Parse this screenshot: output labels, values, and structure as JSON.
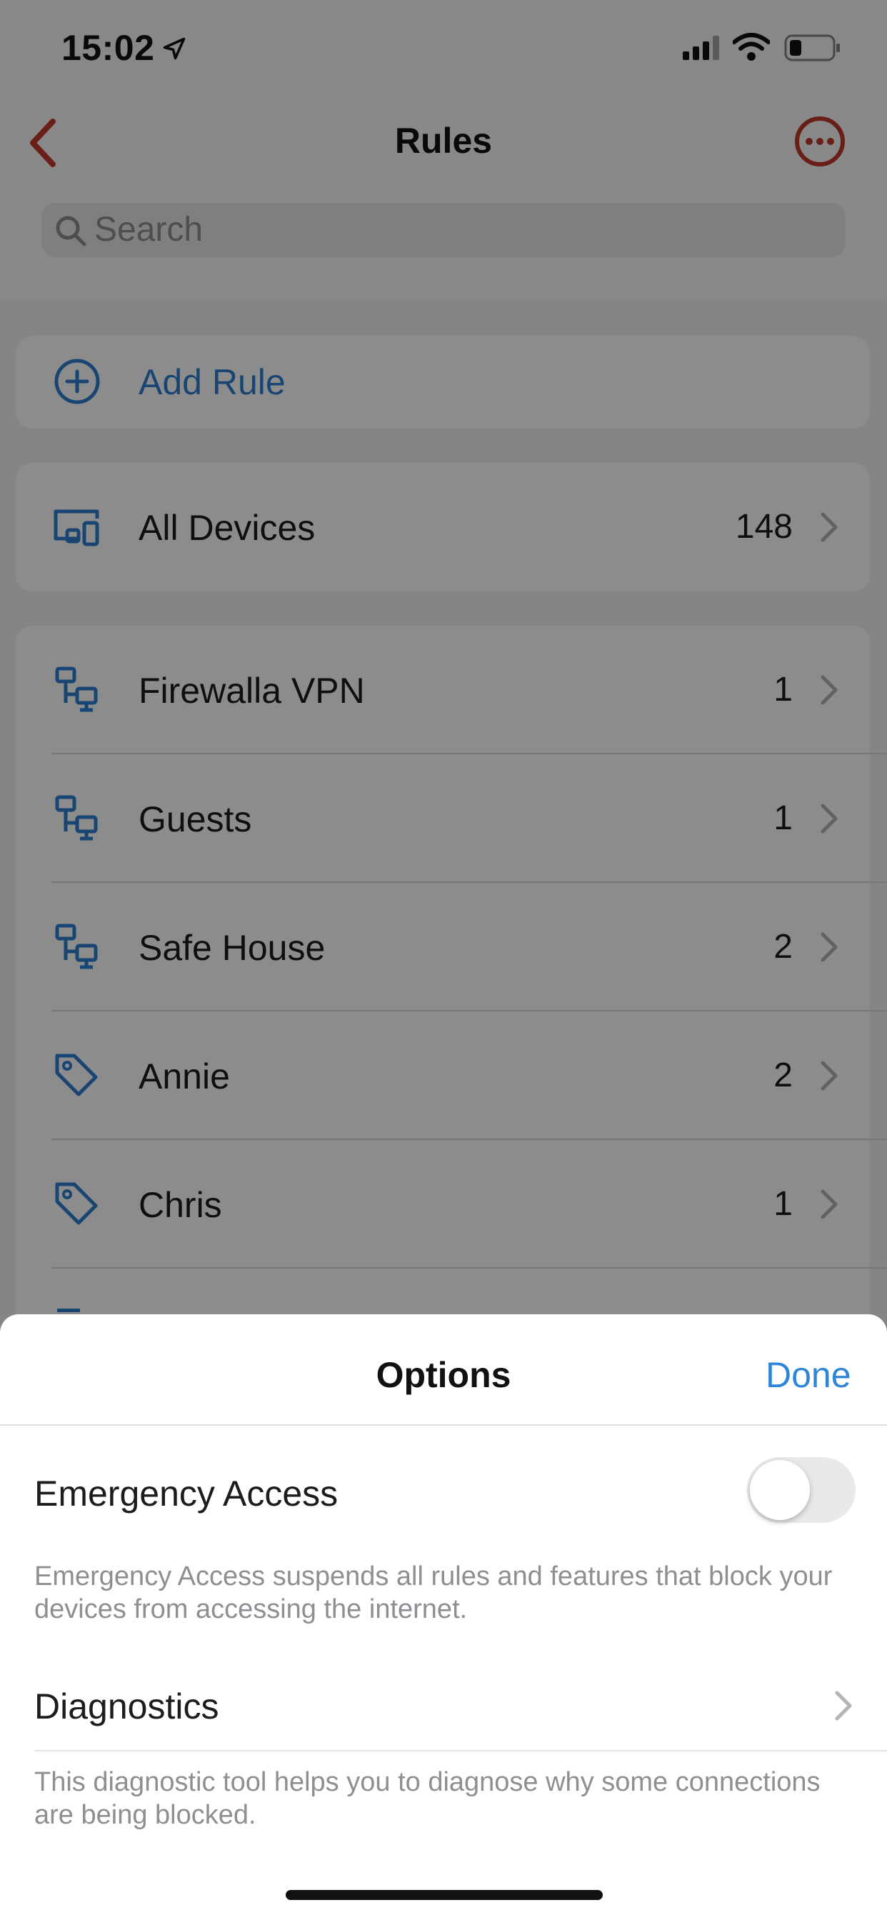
{
  "status_bar": {
    "time": "15:02"
  },
  "nav": {
    "title": "Rules"
  },
  "search": {
    "placeholder": "Search"
  },
  "add_rule": {
    "label": "Add Rule"
  },
  "all_devices": {
    "label": "All Devices",
    "count": "148"
  },
  "rows": [
    {
      "label": "Firewalla VPN",
      "count": "1",
      "icon": "network-icon"
    },
    {
      "label": "Guests",
      "count": "1",
      "icon": "network-icon"
    },
    {
      "label": "Safe House",
      "count": "2",
      "icon": "network-icon"
    },
    {
      "label": "Annie",
      "count": "2",
      "icon": "tag-icon"
    },
    {
      "label": "Chris",
      "count": "1",
      "icon": "tag-icon"
    }
  ],
  "options_sheet": {
    "title": "Options",
    "done_label": "Done",
    "emergency": {
      "label": "Emergency Access",
      "enabled": false,
      "description": "Emergency Access suspends all rules and features that block your devices from accessing the internet."
    },
    "diagnostics": {
      "label": "Diagnostics",
      "description": "This diagnostic tool helps you to diagnose why some connections are being blocked."
    }
  },
  "colors": {
    "accent_red": "#c0392b",
    "accent_blue": "#2f7fd0",
    "done_blue": "#2f86d6"
  }
}
